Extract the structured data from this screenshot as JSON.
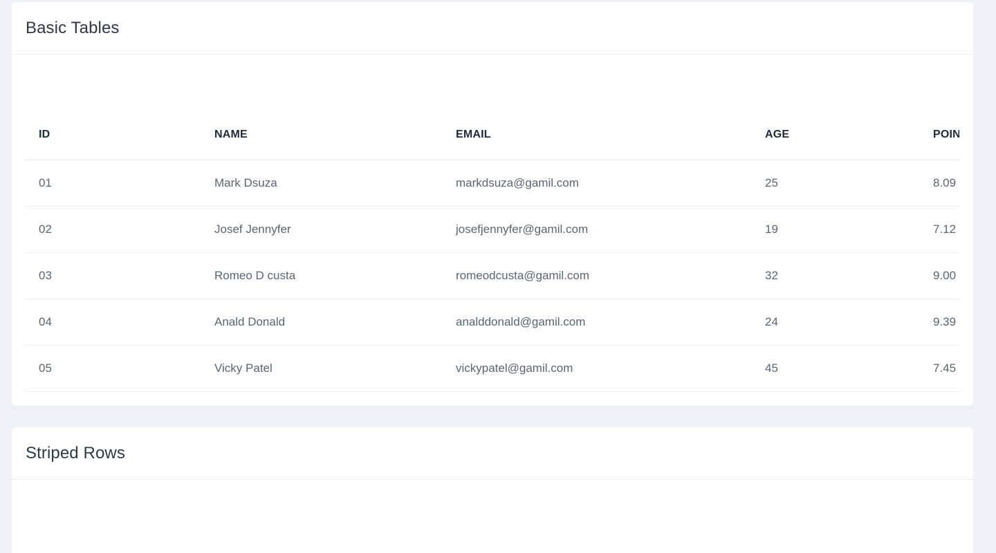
{
  "basic_tables": {
    "title": "Basic Tables",
    "columns": [
      "ID",
      "NAME",
      "EMAIL",
      "AGE",
      "POINT"
    ],
    "rows": [
      [
        "01",
        "Mark Dsuza",
        "markdsuza@gamil.com",
        "25",
        "8.09"
      ],
      [
        "02",
        "Josef Jennyfer",
        "josefjennyfer@gamil.com",
        "19",
        "7.12"
      ],
      [
        "03",
        "Romeo D custa",
        "romeodcusta@gamil.com",
        "32",
        "9.00"
      ],
      [
        "04",
        "Anald Donald",
        "analddonald@gamil.com",
        "24",
        "9.39"
      ],
      [
        "05",
        "Vicky Patel",
        "vickypatel@gamil.com",
        "45",
        "7.45"
      ]
    ]
  },
  "striped_rows": {
    "title": "Striped Rows"
  },
  "colors": {
    "background": "#eef2f7",
    "card": "#ffffff",
    "border": "#e9edf2",
    "heading": "#2f3848",
    "text": "#5c6473"
  }
}
